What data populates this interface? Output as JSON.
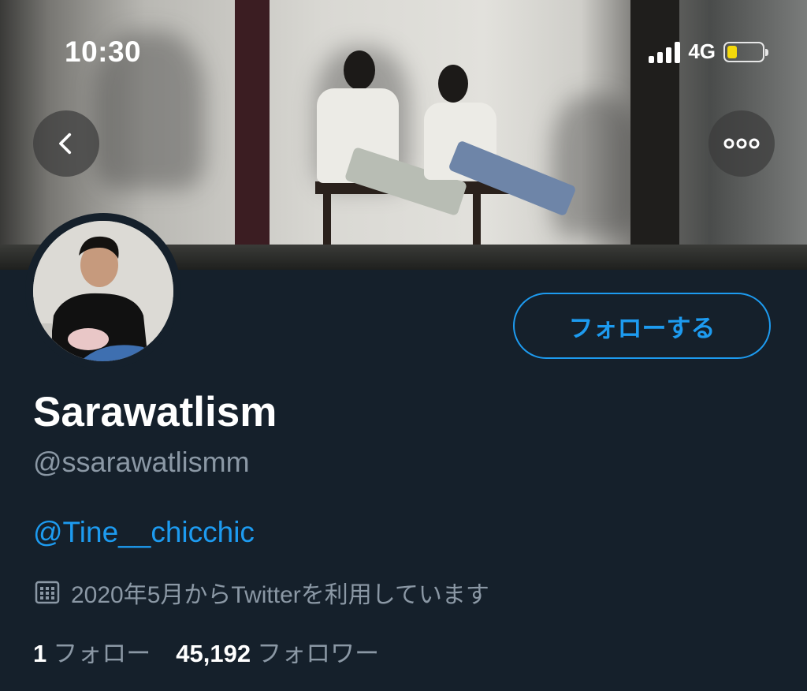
{
  "status_bar": {
    "time": "10:30",
    "network": "4G"
  },
  "profile": {
    "display_name": "Sarawatlism",
    "handle": "@ssarawatlismm",
    "bio_link": "@Tine__chicchic",
    "joined": "2020年5月からTwitterを利用しています",
    "following_count": "1",
    "following_label": "フォロー",
    "followers_count": "45,192",
    "followers_label": "フォロワー"
  },
  "actions": {
    "follow_label": "フォローする"
  },
  "icons": {
    "back": "chevron-left-icon",
    "more": "more-horizontal-icon",
    "calendar": "calendar-icon",
    "signal": "cellular-signal-icon",
    "battery": "battery-icon"
  },
  "colors": {
    "background": "#15202b",
    "accent": "#1d9bf0",
    "secondary_text": "#8b98a5",
    "battery": "#f5d90a"
  }
}
